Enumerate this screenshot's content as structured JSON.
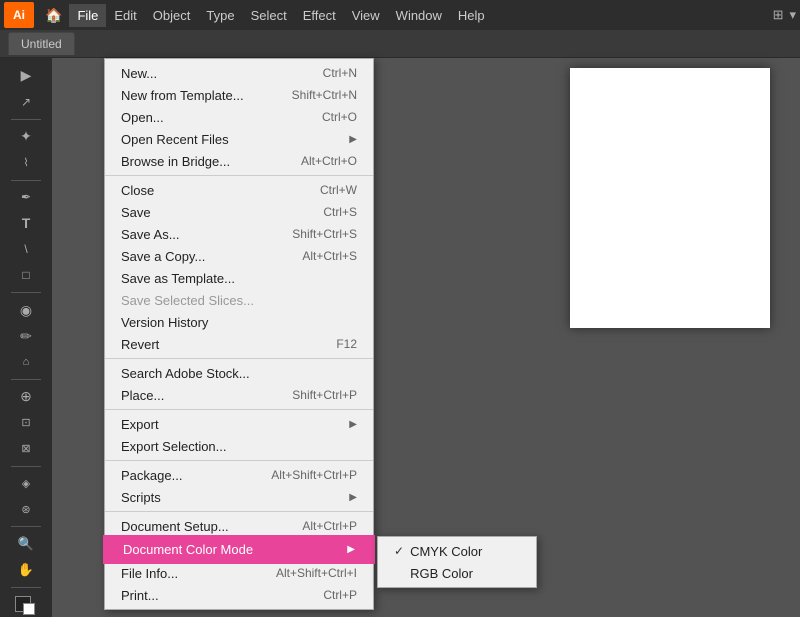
{
  "app": {
    "logo": "Ai",
    "title": "Untitled"
  },
  "menubar": {
    "items": [
      {
        "label": "File",
        "active": true
      },
      {
        "label": "Edit"
      },
      {
        "label": "Object"
      },
      {
        "label": "Type"
      },
      {
        "label": "Select"
      },
      {
        "label": "Effect"
      },
      {
        "label": "View"
      },
      {
        "label": "Window"
      },
      {
        "label": "Help"
      }
    ]
  },
  "file_menu": {
    "sections": [
      {
        "items": [
          {
            "label": "New...",
            "shortcut": "Ctrl+N",
            "disabled": false,
            "arrow": false
          },
          {
            "label": "New from Template...",
            "shortcut": "Shift+Ctrl+N",
            "disabled": false,
            "arrow": false
          },
          {
            "label": "Open...",
            "shortcut": "Ctrl+O",
            "disabled": false,
            "arrow": false
          },
          {
            "label": "Open Recent Files",
            "shortcut": "",
            "disabled": false,
            "arrow": true
          },
          {
            "label": "Browse in Bridge...",
            "shortcut": "Alt+Ctrl+O",
            "disabled": false,
            "arrow": false
          }
        ]
      },
      {
        "items": [
          {
            "label": "Close",
            "shortcut": "Ctrl+W",
            "disabled": false,
            "arrow": false
          },
          {
            "label": "Save",
            "shortcut": "Ctrl+S",
            "disabled": false,
            "arrow": false
          },
          {
            "label": "Save As...",
            "shortcut": "Shift+Ctrl+S",
            "disabled": false,
            "arrow": false
          },
          {
            "label": "Save a Copy...",
            "shortcut": "Alt+Ctrl+S",
            "disabled": false,
            "arrow": false
          },
          {
            "label": "Save as Template...",
            "shortcut": "",
            "disabled": false,
            "arrow": false
          },
          {
            "label": "Save Selected Slices...",
            "shortcut": "",
            "disabled": true,
            "arrow": false
          },
          {
            "label": "Version History",
            "shortcut": "",
            "disabled": false,
            "arrow": false
          },
          {
            "label": "Revert",
            "shortcut": "F12",
            "disabled": false,
            "arrow": false
          }
        ]
      },
      {
        "items": [
          {
            "label": "Search Adobe Stock...",
            "shortcut": "",
            "disabled": false,
            "arrow": false
          },
          {
            "label": "Place...",
            "shortcut": "Shift+Ctrl+P",
            "disabled": false,
            "arrow": false
          }
        ]
      },
      {
        "items": [
          {
            "label": "Export",
            "shortcut": "",
            "disabled": false,
            "arrow": true
          },
          {
            "label": "Export Selection...",
            "shortcut": "",
            "disabled": false,
            "arrow": false
          }
        ]
      },
      {
        "items": [
          {
            "label": "Package...",
            "shortcut": "Alt+Shift+Ctrl+P",
            "disabled": false,
            "arrow": false
          },
          {
            "label": "Scripts",
            "shortcut": "",
            "disabled": false,
            "arrow": true
          }
        ]
      },
      {
        "items": [
          {
            "label": "Document Setup...",
            "shortcut": "Alt+Ctrl+P",
            "disabled": false,
            "arrow": false
          },
          {
            "label": "Document Color Mode",
            "shortcut": "",
            "disabled": false,
            "arrow": true,
            "highlighted": true
          },
          {
            "label": "File Info...",
            "shortcut": "Alt+Shift+Ctrl+I",
            "disabled": false,
            "arrow": false
          },
          {
            "label": "Print...",
            "shortcut": "",
            "disabled": false,
            "arrow": false
          }
        ]
      }
    ],
    "submenu_color": {
      "items": [
        {
          "label": "CMYK Color",
          "checked": true
        },
        {
          "label": "RGB Color",
          "checked": false
        }
      ]
    }
  },
  "tools": [
    {
      "icon": "▶",
      "name": "selection-tool"
    },
    {
      "icon": "↗",
      "name": "direct-selection-tool"
    },
    {
      "icon": "✦",
      "name": "magic-wand-tool"
    },
    {
      "icon": "∞",
      "name": "lasso-tool"
    },
    {
      "icon": "✒",
      "name": "pen-tool"
    },
    {
      "icon": "T",
      "name": "type-tool"
    },
    {
      "icon": "⌇",
      "name": "line-tool"
    },
    {
      "icon": "□",
      "name": "rectangle-tool"
    },
    {
      "icon": "◉",
      "name": "paintbrush-tool"
    },
    {
      "icon": "✏",
      "name": "pencil-tool"
    },
    {
      "icon": "⌂",
      "name": "blob-brush"
    },
    {
      "icon": "⊕",
      "name": "rotate-tool"
    },
    {
      "icon": "🔗",
      "name": "scale-tool"
    },
    {
      "icon": "⊡",
      "name": "free-transform"
    },
    {
      "icon": "◈",
      "name": "shape-builder"
    },
    {
      "icon": "⌀",
      "name": "symbol-tool"
    },
    {
      "icon": "🔍",
      "name": "zoom-tool"
    },
    {
      "icon": "✋",
      "name": "hand-tool"
    }
  ]
}
